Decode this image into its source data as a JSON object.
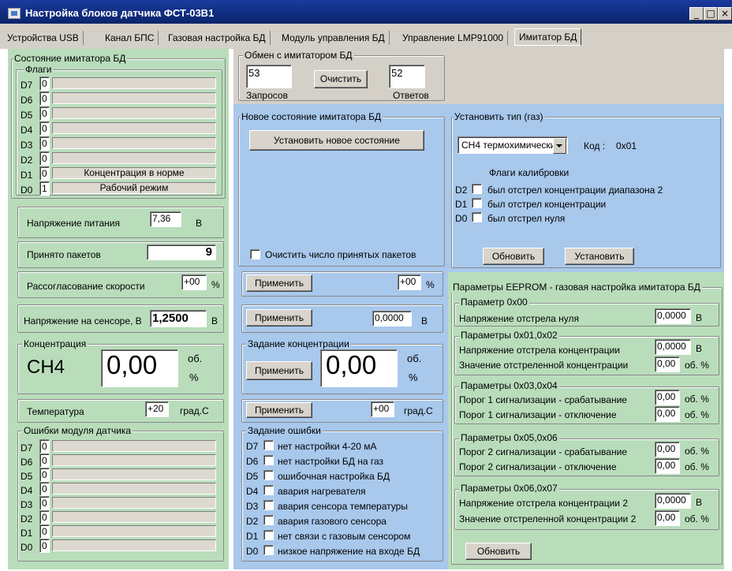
{
  "window": {
    "title": "Настройка блоков датчика ФСТ-03В1",
    "min": "_",
    "max": "□",
    "close": "×"
  },
  "tabs": [
    {
      "label": "Устройства USB"
    },
    {
      "label": "Канал БПС"
    },
    {
      "label": "Газовая настройка БД"
    },
    {
      "label": "Модуль управления БД"
    },
    {
      "label": "Управление LMP91000"
    },
    {
      "label": "Имитатор БД"
    }
  ],
  "state": {
    "title": "Состояние имитатора БД",
    "flags_title": "Флаги",
    "flags": [
      {
        "bit": "D7",
        "value": "0",
        "text": ""
      },
      {
        "bit": "D6",
        "value": "0",
        "text": ""
      },
      {
        "bit": "D5",
        "value": "0",
        "text": ""
      },
      {
        "bit": "D4",
        "value": "0",
        "text": ""
      },
      {
        "bit": "D3",
        "value": "0",
        "text": ""
      },
      {
        "bit": "D2",
        "value": "0",
        "text": ""
      },
      {
        "bit": "D1",
        "value": "0",
        "text": "Концентрация в норме"
      },
      {
        "bit": "D0",
        "value": "1",
        "text": "Рабочий режим"
      }
    ],
    "supply": {
      "label": "Напряжение питания",
      "value": "7,36",
      "unit": "В"
    },
    "packets": {
      "label": "Принято пакетов",
      "value": "9"
    },
    "speed": {
      "label": "Рассогласование скорости",
      "value": "+00",
      "unit": "%"
    },
    "sensor": {
      "label": "Напряжение на сенсоре, В",
      "value": "1,2500",
      "unit": "В"
    },
    "conc": {
      "title": "Концентрация",
      "gas": "CH4",
      "value": "0,00",
      "unit1": "об.",
      "unit2": "%"
    },
    "temp": {
      "label": "Температура",
      "value": "+20",
      "unit": "град.С"
    },
    "errors_title": "Ошибки модуля датчика",
    "errors": [
      {
        "bit": "D7",
        "value": "0"
      },
      {
        "bit": "D6",
        "value": "0"
      },
      {
        "bit": "D5",
        "value": "0"
      },
      {
        "bit": "D4",
        "value": "0"
      },
      {
        "bit": "D3",
        "value": "0"
      },
      {
        "bit": "D2",
        "value": "0"
      },
      {
        "bit": "D1",
        "value": "0"
      },
      {
        "bit": "D0",
        "value": "0"
      }
    ]
  },
  "exchange": {
    "title": "Обмен с имитатором БД",
    "requests": "53",
    "replies": "52",
    "clear_btn": "Очистить",
    "requests_label": "Запросов",
    "replies_label": "Ответов"
  },
  "newstate": {
    "title": "Новое состояние имитатора БД",
    "set_btn": "Установить новое состояние",
    "clear_packets_label": "Очистить число принятых пакетов",
    "apply": "Применить",
    "speed_value": "+00",
    "speed_unit": "%",
    "voltage_value": "0,0000",
    "voltage_unit": "В",
    "conc_title": "Задание концентрации",
    "conc_value": "0,00",
    "conc_unit1": "об.",
    "conc_unit2": "%",
    "temp_value": "+00",
    "temp_unit": "град.С",
    "err_title": "Задание ошибки",
    "errors": [
      {
        "bit": "D7",
        "label": "нет настройки 4-20 мА"
      },
      {
        "bit": "D6",
        "label": "нет настройки БД на газ"
      },
      {
        "bit": "D5",
        "label": "ошибочная настройка БД"
      },
      {
        "bit": "D4",
        "label": "авария нагревателя"
      },
      {
        "bit": "D3",
        "label": "авария сенсора температуры"
      },
      {
        "bit": "D2",
        "label": "авария газового сенсора"
      },
      {
        "bit": "D1",
        "label": "нет связи с газовым сенсором"
      },
      {
        "bit": "D0",
        "label": "низкое напряжение на входе БД"
      }
    ]
  },
  "gastype": {
    "title": "Установить тип (газ)",
    "selected": "CH4 термохимический",
    "code_label": "Код :",
    "code": "0x01",
    "calib_title": "Флаги калибровки",
    "calib": [
      {
        "bit": "D2",
        "label": "был отстрел концентрации диапазона 2"
      },
      {
        "bit": "D1",
        "label": "был отстрел концентрации"
      },
      {
        "bit": "D0",
        "label": "был отстрел нуля"
      }
    ],
    "refresh_btn": "Обновить",
    "set_btn": "Установить"
  },
  "eeprom": {
    "title": "Параметры EEPROM - газовая настройка имитатора БД",
    "p00": {
      "title": "Параметр 0x00",
      "label": "Напряжение отстрела нуля",
      "value": "0,0000",
      "unit": "В"
    },
    "p01": {
      "title": "Параметры 0x01,0x02",
      "l1": "Напряжение отстрела концентрации",
      "v1": "0,0000",
      "u1": "В",
      "l2": "Значение отстреленной концентрации",
      "v2": "0,00",
      "u2": "об. %"
    },
    "p03": {
      "title": "Параметры 0x03,0x04",
      "l1": "Порог 1 сигнализации - срабатывание",
      "v1": "0,00",
      "u1": "об. %",
      "l2": "Порог 1 сигнализации - отключение",
      "v2": "0,00",
      "u2": "об. %"
    },
    "p05": {
      "title": "Параметры 0x05,0x06",
      "l1": "Порог 2 сигнализации - срабатывание",
      "v1": "0,00",
      "u1": "об. %",
      "l2": "Порог 2 сигнализации - отключение",
      "v2": "0,00",
      "u2": "об. %"
    },
    "p06": {
      "title": "Параметры 0x06,0x07",
      "l1": "Напряжение отстрела концентрации  2",
      "v1": "0,0000",
      "u1": "В",
      "l2": "Значение отстреленной концентрации 2",
      "v2": "0,00",
      "u2": "об. %"
    },
    "refresh_btn": "Обновить"
  }
}
